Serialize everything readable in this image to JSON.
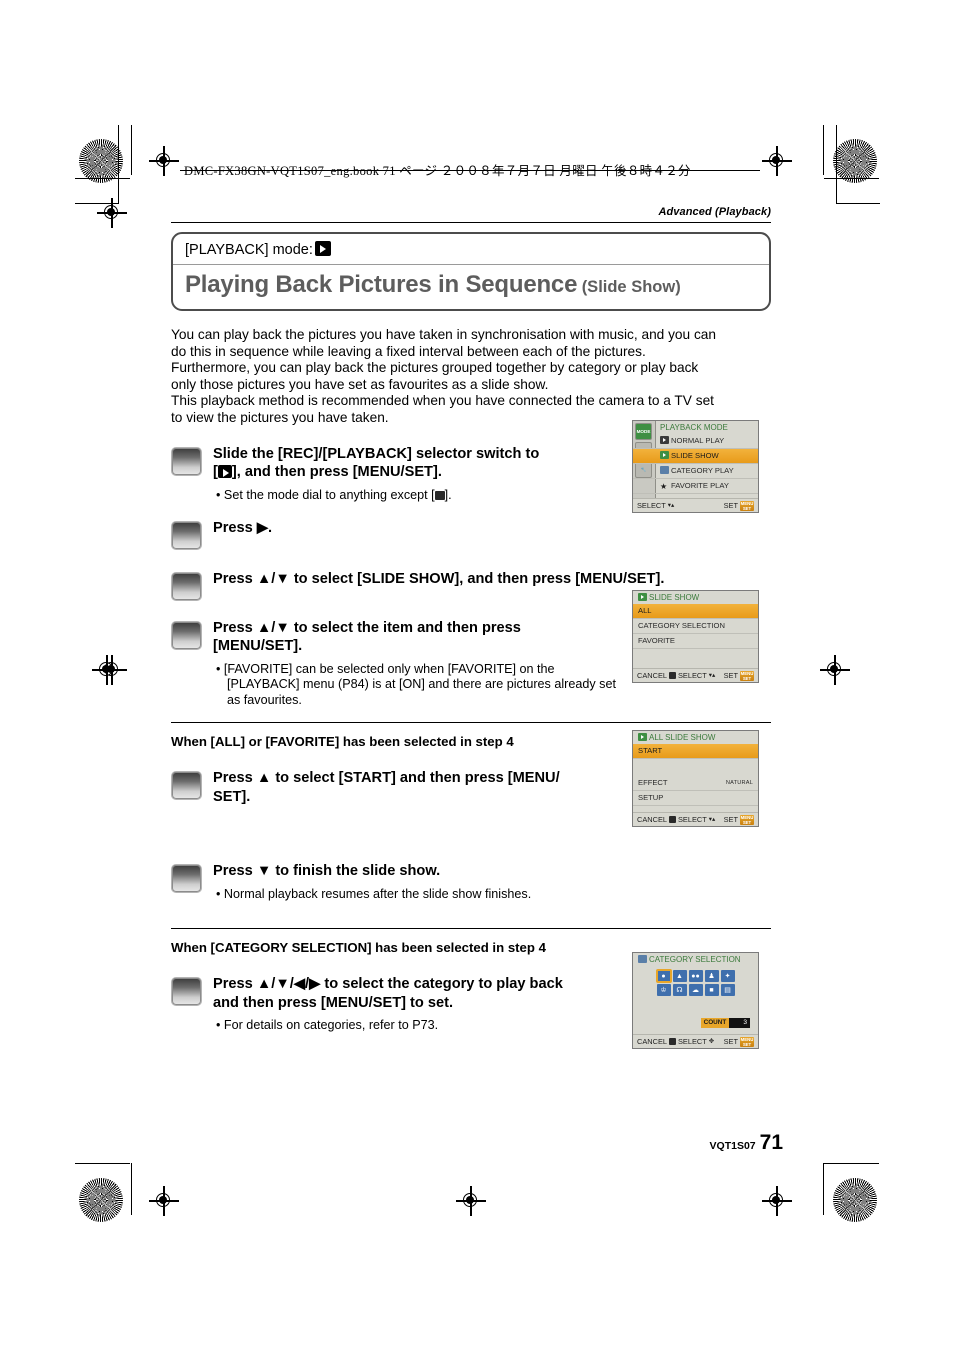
{
  "print_header": "DMC-FX38GN-VQT1S07_eng.book   71 ページ   ２００８年７月７日   月曜日   午後８時４２分",
  "chapter_tag": "Advanced (Playback)",
  "title_box": {
    "mode_label": "[PLAYBACK] mode:",
    "mode_icon": "playback-icon",
    "title_main": "Playing Back Pictures in Sequence",
    "title_sub": "(Slide Show)"
  },
  "intro": "You can play back the pictures you have taken in synchronisation with music, and you can do this in sequence while leaving a fixed interval between each of the pictures. Furthermore, you can play back the pictures grouped together by category or play back only those pictures you have set as favourites as a slide show. This playback method is recommended when you have connected the camera to a TV set to view the pictures you have taken.",
  "steps": [
    {
      "title": "Slide the [REC]/[PLAYBACK] selector switch to [▶], and then press [MENU/SET].",
      "bullet": "Set the mode dial to anything except [■]."
    },
    {
      "title": "Press ▶."
    },
    {
      "title": "Press ▲/▼ to select [SLIDE SHOW], and then press [MENU/SET]."
    },
    {
      "title": "Press ▲/▼ to select the item and then press [MENU/SET].",
      "bullet": "[FAVORITE] can be selected only when [FAVORITE] on the [PLAYBACK] menu (P84) is at [ON] and there are pictures already set as favourites."
    },
    {
      "title": "Press ▲ to select [START] and then press [MENU/SET]."
    },
    {
      "title": "Press ▼ to finish the slide show.",
      "bullet": "Normal playback resumes after the slide show finishes."
    },
    {
      "title": "Press ▲/▼/◀/▶ to select the category to play back and then press [MENU/SET] to set.",
      "bullet": "For details on categories, refer to P73."
    }
  ],
  "section_headings": {
    "all_favorite": "When [ALL] or [FAVORITE] has been selected in step 4",
    "category": "When [CATEGORY SELECTION] has been selected in step 4"
  },
  "lcd_playback_mode": {
    "header": "PLAYBACK MODE",
    "tabs": [
      "MODE",
      "playback-tab-icon",
      "wrench-tab-icon"
    ],
    "items": [
      {
        "label": "NORMAL PLAY",
        "icon": "play-icon",
        "selected": false
      },
      {
        "label": "SLIDE SHOW",
        "icon": "slideshow-icon",
        "selected": true
      },
      {
        "label": "CATEGORY PLAY",
        "icon": "category-icon",
        "selected": false
      },
      {
        "label": "FAVORITE PLAY",
        "icon": "star-icon",
        "selected": false
      }
    ],
    "footer": {
      "select": "SELECT",
      "set": "SET",
      "set_btn_top": "MENU",
      "set_btn_bottom": "SET"
    }
  },
  "lcd_slide_show": {
    "header": "SLIDE SHOW",
    "items": [
      {
        "label": "ALL",
        "selected": true
      },
      {
        "label": "CATEGORY SELECTION",
        "selected": false
      },
      {
        "label": "FAVORITE",
        "selected": false
      }
    ],
    "footer": {
      "cancel": "CANCEL",
      "select": "SELECT",
      "set": "SET",
      "set_btn_top": "MENU",
      "set_btn_bottom": "SET"
    }
  },
  "lcd_all_slide_show": {
    "header": "ALL SLIDE SHOW",
    "items": [
      {
        "label": "START",
        "selected": true,
        "value": ""
      },
      {
        "label": "EFFECT",
        "selected": false,
        "value": "NATURAL"
      },
      {
        "label": "SETUP",
        "selected": false,
        "value": ""
      }
    ],
    "footer": {
      "cancel": "CANCEL",
      "select": "SELECT",
      "set": "SET",
      "set_btn_top": "MENU",
      "set_btn_bottom": "SET"
    }
  },
  "lcd_category_selection": {
    "header": "CATEGORY SELECTION",
    "icons_row1": [
      "portrait-icon",
      "scenery-icon",
      "group-icon",
      "baby-icon",
      "pet-icon"
    ],
    "icons_row2": [
      "animal-icon",
      "food-icon",
      "travel-icon",
      "building-icon",
      "movie-icon"
    ],
    "selected_index": 0,
    "count_label": "COUNT",
    "count_value": "3",
    "footer": {
      "cancel": "CANCEL",
      "select": "SELECT",
      "set": "SET",
      "set_btn_top": "MENU",
      "set_btn_bottom": "SET"
    }
  },
  "page_footer": {
    "doc_code": "VQT1S07",
    "page_number": "71"
  }
}
